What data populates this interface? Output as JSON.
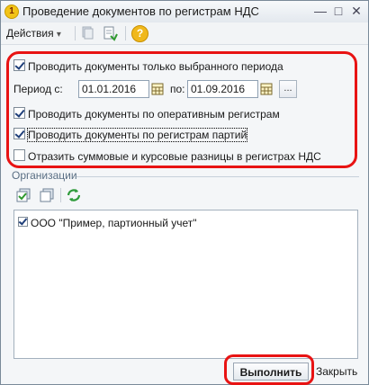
{
  "window": {
    "title": "Проведение документов по регистрам НДС",
    "icon_glyph": "1",
    "controls": {
      "minimize": "—",
      "maximize": "□",
      "close": "✕"
    }
  },
  "toolbar": {
    "actions_label": "Действия",
    "actions_arrow": "▾",
    "help_glyph": "?"
  },
  "settings": {
    "only_selected_period": {
      "label": "Проводить документы только выбранного периода",
      "checked": true
    },
    "period": {
      "label": "Период с:",
      "from": "01.01.2016",
      "to_label": "по:",
      "to": "01.09.2016",
      "more_button": "..."
    },
    "operational_registers": {
      "label": "Проводить документы по оперативным регистрам",
      "checked": true
    },
    "batch_registers": {
      "label": "Проводить документы по регистрам партий",
      "checked": true
    },
    "sum_rate_differences": {
      "label": "Отразить суммовые и курсовые разницы в регистрах НДС",
      "checked": false
    }
  },
  "organizations": {
    "section_title": "Организации",
    "items": [
      {
        "name": "ООО \"Пример, партионный учет\"",
        "checked": true
      }
    ]
  },
  "footer": {
    "run_button": "Выполнить",
    "close_button": "Закрыть"
  },
  "colors": {
    "highlight_red": "#e81313",
    "section_title": "#5a6f84",
    "check_mark": "#1f3f7a"
  }
}
